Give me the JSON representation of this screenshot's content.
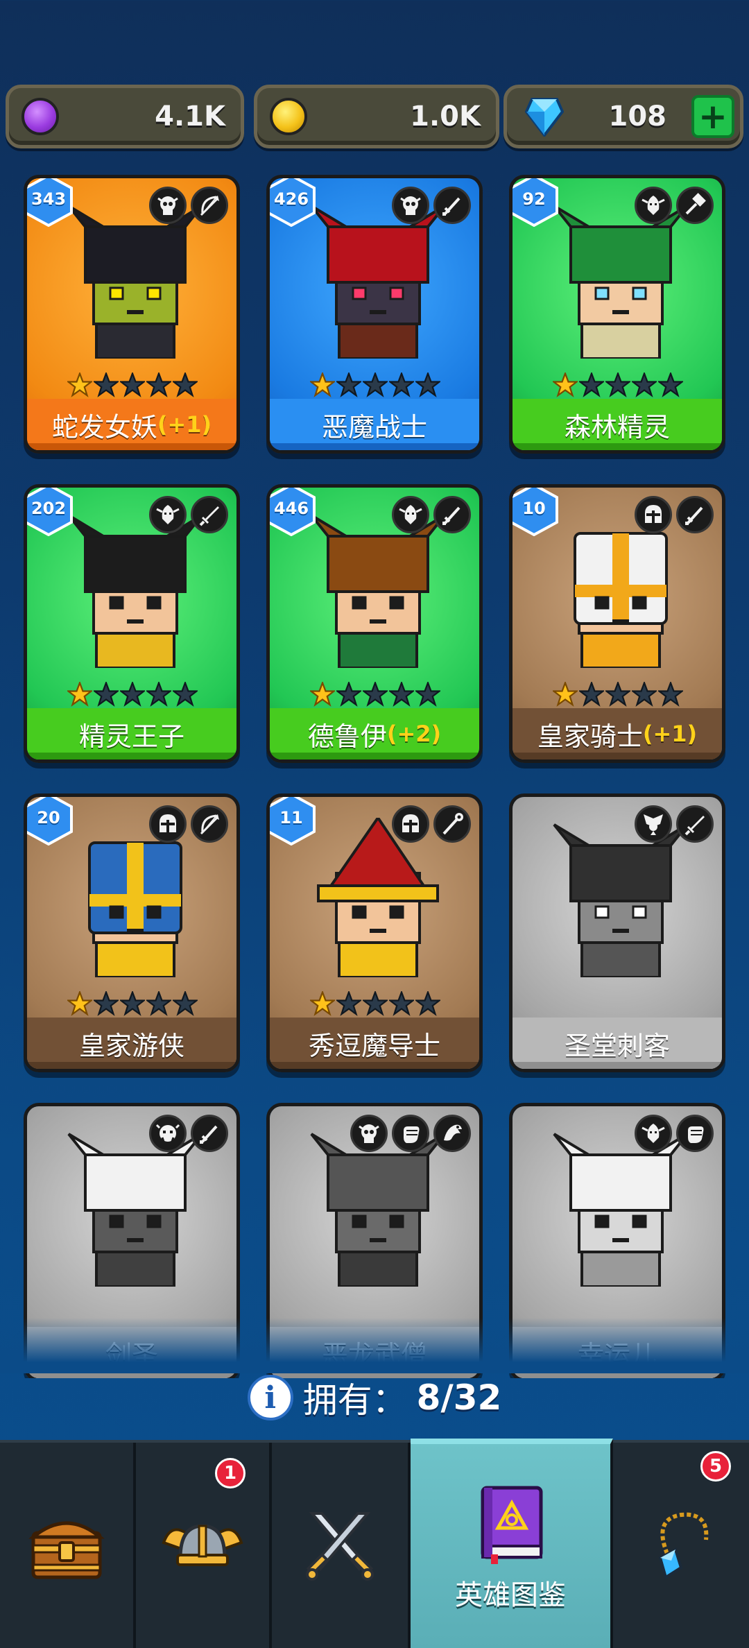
{
  "currency": {
    "purple": {
      "value": "4.1K",
      "icon": "purple-coin-icon"
    },
    "gold": {
      "value": "1.0K",
      "icon": "gold-coin-icon"
    },
    "gems": {
      "value": "108",
      "icon": "gem-icon",
      "add_label": "+"
    }
  },
  "heroes": [
    {
      "name": "蛇发女妖",
      "bonus": "(+1)",
      "level": "343",
      "stars": 1,
      "theme": "orange",
      "roles": [
        "skull-icon",
        "bow-icon"
      ],
      "locked": false
    },
    {
      "name": "恶魔战士",
      "bonus": "",
      "level": "426",
      "stars": 1,
      "theme": "blue",
      "roles": [
        "skull-icon",
        "sword-icon"
      ],
      "locked": false
    },
    {
      "name": "森林精灵",
      "bonus": "",
      "level": "92",
      "stars": 1,
      "theme": "green",
      "roles": [
        "elf-icon",
        "hammer-icon"
      ],
      "locked": false
    },
    {
      "name": "精灵王子",
      "bonus": "",
      "level": "202",
      "stars": 1,
      "theme": "green",
      "roles": [
        "elf-icon",
        "dagger-icon"
      ],
      "locked": false
    },
    {
      "name": "德鲁伊",
      "bonus": "(+2)",
      "level": "446",
      "stars": 1,
      "theme": "green",
      "roles": [
        "elf-icon",
        "sword-icon"
      ],
      "locked": false
    },
    {
      "name": "皇家骑士",
      "bonus": "(+1)",
      "level": "10",
      "stars": 1,
      "theme": "brown",
      "roles": [
        "helmet-icon",
        "sword-icon"
      ],
      "locked": false
    },
    {
      "name": "皇家游侠",
      "bonus": "",
      "level": "20",
      "stars": 1,
      "theme": "brown",
      "roles": [
        "helmet-icon",
        "bow-icon"
      ],
      "locked": false
    },
    {
      "name": "秀逗魔导士",
      "bonus": "",
      "level": "11",
      "stars": 1,
      "theme": "brown",
      "roles": [
        "helmet-icon",
        "staff-icon"
      ],
      "locked": false
    },
    {
      "name": "圣堂刺客",
      "bonus": "",
      "level": "",
      "stars": 0,
      "theme": "locked",
      "roles": [
        "winged-icon",
        "dagger-icon"
      ],
      "locked": true
    },
    {
      "name": "剑圣",
      "bonus": "",
      "level": "",
      "stars": 0,
      "theme": "locked",
      "roles": [
        "orc-icon",
        "sword-icon"
      ],
      "locked": true
    },
    {
      "name": "恶龙武僧",
      "bonus": "",
      "level": "",
      "stars": 0,
      "theme": "locked",
      "roles": [
        "skull-icon",
        "fist-icon",
        "dragon-icon"
      ],
      "locked": true
    },
    {
      "name": "幸运儿",
      "bonus": "",
      "level": "",
      "stars": 0,
      "theme": "locked",
      "roles": [
        "elf-icon",
        "fist-icon"
      ],
      "locked": true
    }
  ],
  "owned": {
    "label": "拥有：",
    "value": "8/32"
  },
  "nav": {
    "tabs": [
      {
        "id": "shop",
        "icon": "treasure-chest-icon",
        "label": "",
        "badge": ""
      },
      {
        "id": "heroes",
        "icon": "viking-helmet-icon",
        "label": "",
        "badge": "1"
      },
      {
        "id": "battle",
        "icon": "crossed-swords-icon",
        "label": "",
        "badge": ""
      },
      {
        "id": "collection",
        "icon": "spellbook-icon",
        "label": "英雄图鉴",
        "badge": "",
        "active": true
      },
      {
        "id": "items",
        "icon": "amulet-icon",
        "label": "",
        "badge": "5"
      }
    ]
  },
  "colors": {
    "accent": "#6ec3c9",
    "badge": "#e8223a",
    "bonus": "#ffd21a"
  }
}
